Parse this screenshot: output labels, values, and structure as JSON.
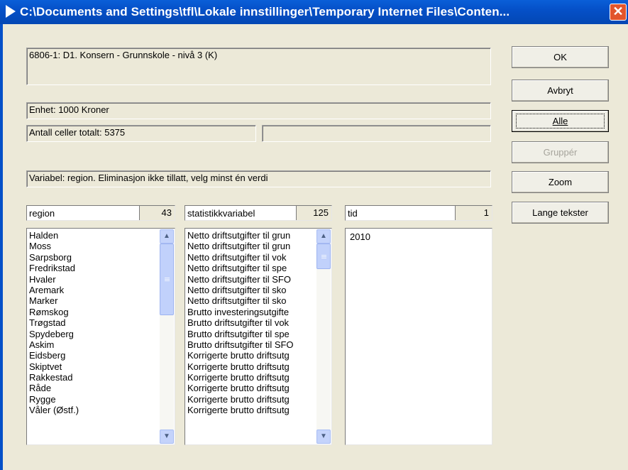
{
  "window": {
    "title": "C:\\Documents and Settings\\tfl\\Lokale innstillinger\\Temporary Internet Files\\Conten...",
    "close_label": "✕"
  },
  "info": {
    "table_title": "6806-1: D1. Konsern - Grunnskole - nivå 3 (K)",
    "unit": "Enhet: 1000 Kroner",
    "cells_total": "Antall celler totalt:  5375",
    "cells_selected": "",
    "variable_hint": "Variabel: region. Eliminasjon ikke tillatt, velg minst én verdi"
  },
  "buttons": {
    "ok": "OK",
    "cancel": "Avbryt",
    "all": "Alle",
    "group": "Gruppér",
    "zoom": "Zoom",
    "long_texts": "Lange tekster"
  },
  "lists": [
    {
      "name": "region",
      "count": "43",
      "items": [
        "Halden",
        "Moss",
        "Sarpsborg",
        "Fredrikstad",
        "Hvaler",
        "Aremark",
        "Marker",
        "Rømskog",
        "Trøgstad",
        "Spydeberg",
        "Askim",
        "Eidsberg",
        "Skiptvet",
        "Rakkestad",
        "Råde",
        "Rygge",
        "Våler (Østf.)"
      ]
    },
    {
      "name": "statistikkvariabel",
      "count": "125",
      "items": [
        "Netto driftsutgifter til grun",
        "Netto driftsutgifter til grun",
        "Netto driftsutgifter til vok",
        "Netto driftsutgifter til spe",
        "Netto driftsutgifter til SFO",
        "Netto driftsutgifter til sko",
        "Netto driftsutgifter til sko",
        "Brutto investeringsutgifte",
        "Brutto driftsutgifter til vok",
        "Brutto driftsutgifter til spe",
        "Brutto driftsutgifter til SFO",
        "Korrigerte brutto driftsutg",
        "Korrigerte brutto driftsutg",
        "Korrigerte brutto driftsutg",
        "Korrigerte brutto driftsutg",
        "Korrigerte brutto driftsutg",
        "Korrigerte brutto driftsutg"
      ]
    },
    {
      "name": "tid",
      "count": "1",
      "items": [
        "2010"
      ]
    }
  ],
  "icons": {
    "app": "app-arrow-icon",
    "close": "close-icon",
    "scroll_up": "scroll-up-icon",
    "scroll_down": "scroll-down-icon"
  },
  "colors": {
    "titlebar": "#0550c8",
    "dialog_bg": "#ece9d8",
    "close_button": "#e2552c",
    "scrollbar": "#c1d1fb"
  }
}
